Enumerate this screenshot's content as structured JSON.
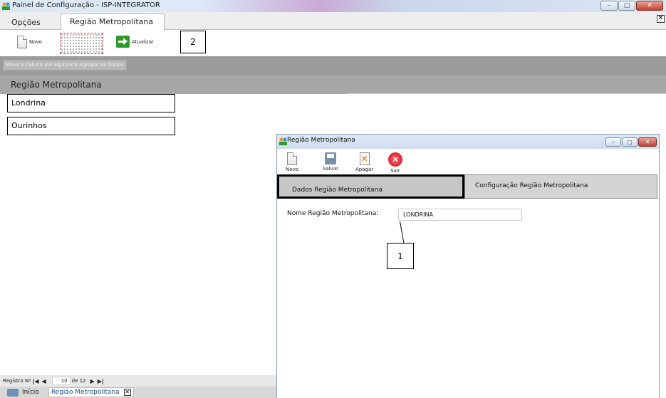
{
  "window": {
    "title": "Painel de Configuração - ISP-INTEGRATOR",
    "minimize_glyph": "–",
    "maximize_glyph": "▢",
    "close_glyph": "✕"
  },
  "tabs": {
    "opcoes": "Opções",
    "active": "Região Metropolitana",
    "close_glyph": "✕"
  },
  "toolbar": {
    "new_label": "Novo",
    "refresh_label": "Atualizar"
  },
  "annotations": {
    "callout_1": "1",
    "callout_2": "2"
  },
  "grid": {
    "group_hint": "Mova a Coluna até aqui para Agrupar os Dados",
    "column_header": "Região Metropolitana",
    "rows": [
      "Londrina",
      "Ourinhos"
    ]
  },
  "pager": {
    "label": "Registro Nº",
    "first": "|◀",
    "prev": "◀",
    "current": "10",
    "of_total": "de 12",
    "next": "▶",
    "last": "▶|"
  },
  "taskbar": {
    "start_label": "Início",
    "item_label": "Região Metropolitana",
    "item_close": "✕"
  },
  "child_window": {
    "title": "Região Metropolitana",
    "toolbar": {
      "new_label": "Novo",
      "save_label": "Salvar",
      "delete_label": "Apagar",
      "exit_label": "Sair",
      "exit_glyph": "✕"
    },
    "tabs": [
      "Dados Região Metropolitana",
      "Configuração Região Metropolitana"
    ],
    "field_label": "Nome Região Metropolitana:",
    "field_value": "LONDRINA"
  },
  "colors": {
    "accent_green": "#2e9a2c",
    "close_red": "#c2412e",
    "group_bar": "#9c9c9c"
  },
  "icons": [
    "app-icon",
    "new-document-icon",
    "refresh-arrow-icon",
    "save-icon",
    "delete-icon",
    "exit-icon",
    "start-icon",
    "close-icon"
  ]
}
